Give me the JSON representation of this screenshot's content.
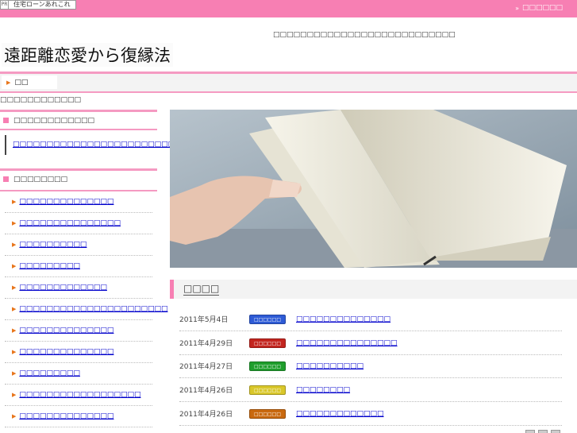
{
  "topbar": {
    "pr_label": "PR",
    "pr_text": "住宅ローンあれこれ",
    "link_label": "□□□□□□",
    "color": "#f77fb3"
  },
  "header": {
    "tagline": "□□□□□□□□□□□□□□□□□□□□□□□□□□□",
    "site_title": "遠距離恋愛から復縁法"
  },
  "nav": {
    "home_label": "□□"
  },
  "breadcrumb": "□□□□□□□□□□□□",
  "sidebar": {
    "contact_heading": "□□□□□□□□□□□□",
    "contact_link": "□□□□□□□□□□□□□□□□□□□□□□□□□",
    "menu_heading": "□□□□□□□□",
    "items": [
      {
        "label": "□□□□□□□□□□□□□□"
      },
      {
        "label": "□□□□□□□□□□□□□□□"
      },
      {
        "label": "□□□□□□□□□□"
      },
      {
        "label": "□□□□□□□□□"
      },
      {
        "label": "□□□□□□□□□□□□□"
      },
      {
        "label": "□□□□□□□□□□□□□□□□□□□□□□"
      },
      {
        "label": "□□□□□□□□□□□□□□"
      },
      {
        "label": "□□□□□□□□□□□□□□"
      },
      {
        "label": "□□□□□□□□□"
      },
      {
        "label": "□□□□□□□□□□□□□□□□□□"
      },
      {
        "label": "□□□□□□□□□□□□□□"
      },
      {
        "label": "□□□□□□□□□□"
      }
    ]
  },
  "news": {
    "heading": "□□□□",
    "items": [
      {
        "date": "2011年5月4日",
        "badge": "□□□□□□",
        "badge_color": "#2e5bd6",
        "title": "□□□□□□□□□□□□□□"
      },
      {
        "date": "2011年4月29日",
        "badge": "□□□□□□",
        "badge_color": "#c3251f",
        "title": "□□□□□□□□□□□□□□□"
      },
      {
        "date": "2011年4月27日",
        "badge": "□□□□□□",
        "badge_color": "#1f9e2c",
        "title": "□□□□□□□□□□"
      },
      {
        "date": "2011年4月26日",
        "badge": "□□□□□□",
        "badge_color": "#d9c72a",
        "title": "□□□□□□□□"
      },
      {
        "date": "2011年4月26日",
        "badge": "□□□□□□",
        "badge_color": "#c9690f",
        "title": "□□□□□□□□□□□□□"
      }
    ]
  }
}
